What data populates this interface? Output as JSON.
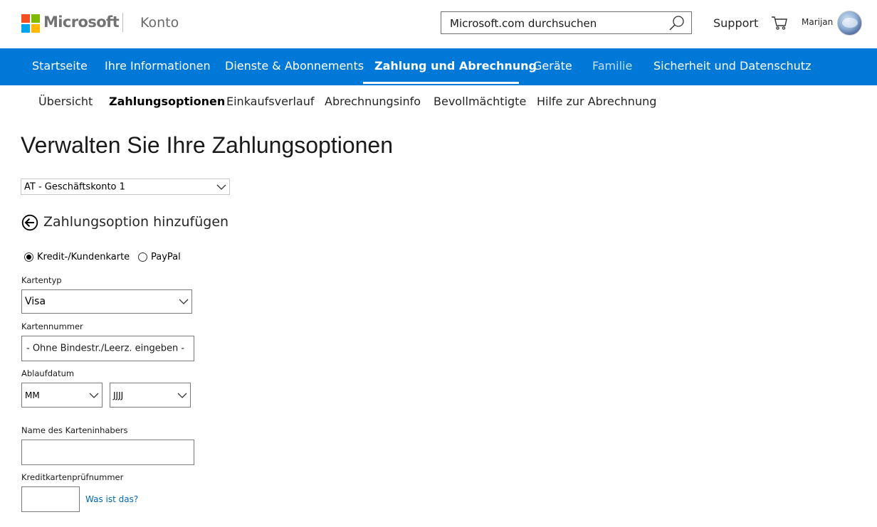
{
  "header": {
    "brand": "Microsoft",
    "section": "Konto",
    "search_placeholder": "Microsoft.com durchsuchen",
    "support": "Support",
    "user_name": "Marijan",
    "logo_colors": [
      "#f25022",
      "#7fba00",
      "#00a4ef",
      "#ffb900"
    ]
  },
  "nav": {
    "items": [
      {
        "label": "Startseite"
      },
      {
        "label": "Ihre Informationen"
      },
      {
        "label": "Dienste & Abonnements"
      },
      {
        "label": "Zahlung und Abrechnung",
        "active": true
      },
      {
        "label": "Geräte"
      },
      {
        "label": "Familie"
      },
      {
        "label": "Sicherheit und Datenschutz"
      }
    ],
    "color": "#0078d7"
  },
  "subnav": {
    "items": [
      {
        "label": "Übersicht"
      },
      {
        "label": "Zahlungsoptionen",
        "active": true
      },
      {
        "label": "Einkaufsverlauf"
      },
      {
        "label": "Abrechnungsinfo"
      },
      {
        "label": "Bevollmächtigte"
      },
      {
        "label": "Hilfe zur Abrechnung"
      }
    ]
  },
  "main": {
    "title": "Verwalten Sie Ihre Zahlungsoptionen",
    "account_select": "AT - Geschäftskonto 1",
    "back_label": "Zahlungsoption hinzufügen",
    "payment_types": [
      {
        "label": "Kredit-/Kundenkarte",
        "checked": true
      },
      {
        "label": "PayPal",
        "checked": false
      }
    ],
    "form": {
      "card_type_label": "Kartentyp",
      "card_type_value": "Visa",
      "card_number_label": "Kartennummer",
      "card_number_placeholder": "- Ohne Bindestr./Leerz. eingeben -",
      "expiry_label": "Ablaufdatum",
      "expiry_month": "MM",
      "expiry_year": "JJJJ",
      "holder_label": "Name des Karteninhabers",
      "holder_value": "",
      "cvv_label": "Kreditkartenprüfnummer",
      "cvv_value": "",
      "cvv_help": "Was ist das?"
    }
  }
}
